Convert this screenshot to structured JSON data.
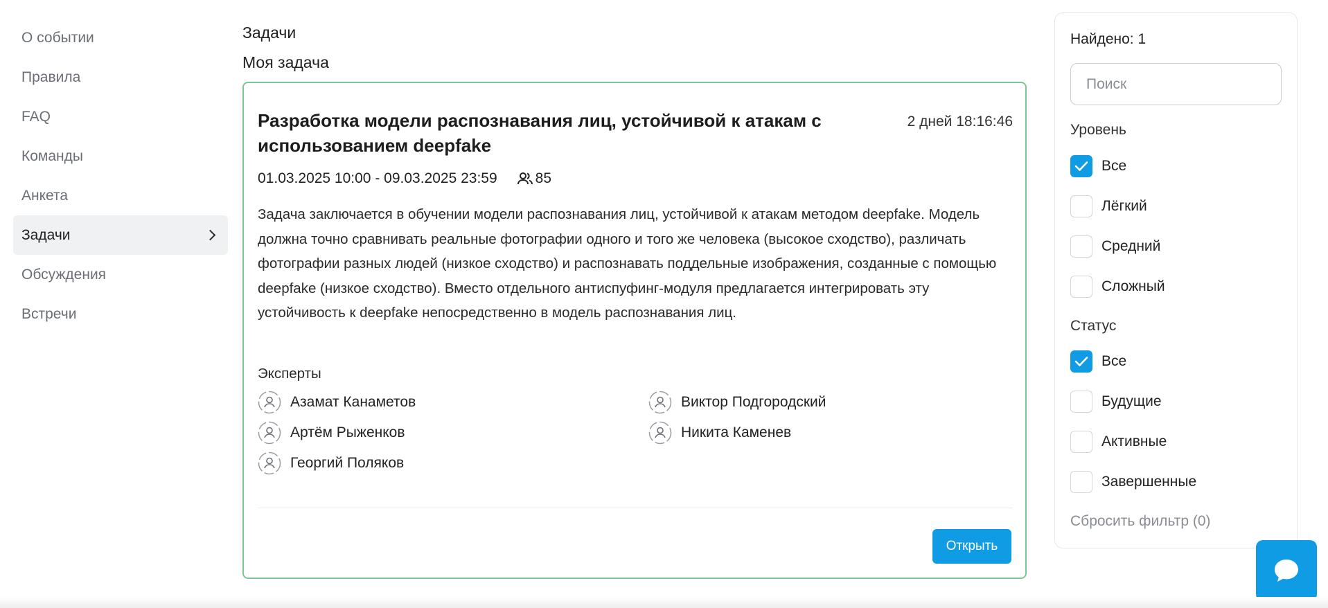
{
  "sidebar": {
    "items": [
      {
        "label": "О событии"
      },
      {
        "label": "Правила"
      },
      {
        "label": "FAQ"
      },
      {
        "label": "Команды"
      },
      {
        "label": "Анкета"
      },
      {
        "label": "Задачи",
        "active": true
      },
      {
        "label": "Обсуждения"
      },
      {
        "label": "Встречи"
      }
    ]
  },
  "main": {
    "section_title": "Задачи",
    "subtitle": "Моя задача",
    "task": {
      "title": "Разработка модели распознавания лиц, устойчивой к атакам с использованием deepfake",
      "timer": "2 дней 18:16:46",
      "dates": "01.03.2025 10:00 - 09.03.2025 23:59",
      "participants": "85",
      "description": "Задача заключается в обучении модели распознавания лиц, устойчивой к атакам методом deepfake. Модель должна точно сравнивать реальные фотографии одного и того же человека (высокое сходство), различать фотографии разных людей (низкое сходство) и распознавать поддельные изображения, созданные с помощью deepfake (низкое сходство). Вместо отдельного антиспуфинг-модуля предлагается интегрировать эту устойчивость к deepfake непосредственно в модель распознавания лиц.",
      "experts_label": "Эксперты",
      "experts": [
        {
          "name": "Азамат Канаметов"
        },
        {
          "name": "Виктор Подгородский"
        },
        {
          "name": "Артём Рыженков"
        },
        {
          "name": "Никита Каменев"
        },
        {
          "name": "Георгий Поляков"
        }
      ],
      "open_label": "Открыть"
    }
  },
  "filter": {
    "found": "Найдено: 1",
    "search_placeholder": "Поиск",
    "level_label": "Уровень",
    "levels": [
      {
        "label": "Все",
        "checked": true
      },
      {
        "label": "Лёгкий",
        "checked": false
      },
      {
        "label": "Средний",
        "checked": false
      },
      {
        "label": "Сложный",
        "checked": false
      }
    ],
    "status_label": "Статус",
    "statuses": [
      {
        "label": "Все",
        "checked": true
      },
      {
        "label": "Будущие",
        "checked": false
      },
      {
        "label": "Активные",
        "checked": false
      },
      {
        "label": "Завершенные",
        "checked": false
      }
    ],
    "reset_label": "Сбросить фильтр (0)"
  },
  "colors": {
    "accent": "#109ce5",
    "card_border": "#7cc596"
  },
  "icons": {
    "nav_active": "chevron-right-icon",
    "participants": "people-icon",
    "expert": "user-avatar-icon",
    "checkbox": "check-icon",
    "chat": "chat-bubble-icon"
  }
}
